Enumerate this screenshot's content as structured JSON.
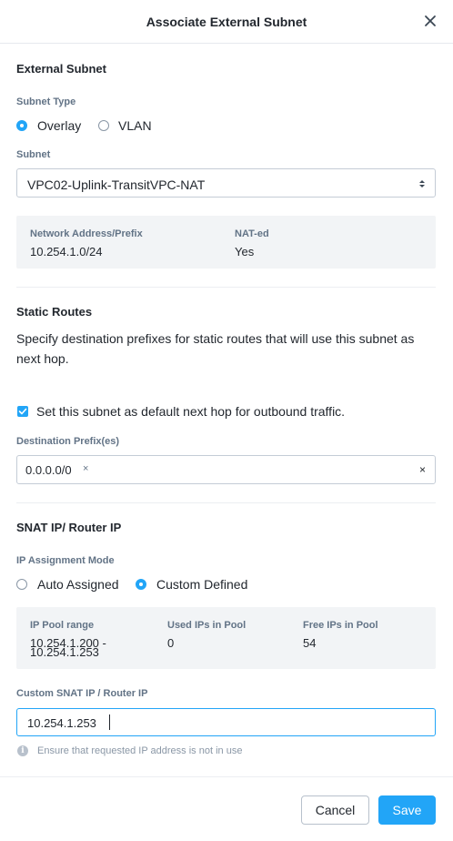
{
  "dialog": {
    "title": "Associate External Subnet"
  },
  "external_subnet": {
    "section_title": "External Subnet",
    "subnet_type_label": "Subnet Type",
    "subnet_type_options": [
      "Overlay",
      "VLAN"
    ],
    "subnet_type_selected": "Overlay",
    "subnet_label": "Subnet",
    "subnet_value": "VPC02-Uplink-TransitVPC-NAT",
    "info": {
      "network_label": "Network Address/Prefix",
      "network_value": "10.254.1.0/24",
      "nat_label": "NAT-ed",
      "nat_value": "Yes"
    }
  },
  "static_routes": {
    "section_title": "Static Routes",
    "description": "Specify destination prefixes for static routes that will use this subnet as next hop.",
    "checkbox_label": "Set this subnet as default next hop for outbound traffic.",
    "checkbox_checked": true,
    "dest_label": "Destination Prefix(es)",
    "dest_tags": [
      "0.0.0.0/0"
    ],
    "tag_remove_glyph": "×",
    "clear_glyph": "×"
  },
  "snat": {
    "section_title": "SNAT IP/ Router IP",
    "mode_label": "IP Assignment Mode",
    "mode_options": [
      "Auto Assigned",
      "Custom Defined"
    ],
    "mode_selected": "Custom Defined",
    "info": {
      "pool_label": "IP Pool range",
      "pool_value_line1": "10.254.1.200 -",
      "pool_value_line2": "10.254.1.253",
      "used_label": "Used IPs in Pool",
      "used_value": "0",
      "free_label": "Free IPs in Pool",
      "free_value": "54"
    },
    "custom_ip_label": "Custom SNAT IP / Router IP",
    "custom_ip_value": "10.254.1.253",
    "hint_icon": "i",
    "hint": "Ensure that requested IP address is not in use"
  },
  "footer": {
    "cancel_label": "Cancel",
    "save_label": "Save"
  },
  "colors": {
    "accent": "#22a5f7",
    "label": "#627386",
    "text": "#22272e",
    "panel": "#f2f4f6"
  },
  "icons": {
    "close": "close-icon",
    "select_arrows": "sort-arrows-icon",
    "check": "checkmark-icon",
    "info": "info-icon"
  }
}
